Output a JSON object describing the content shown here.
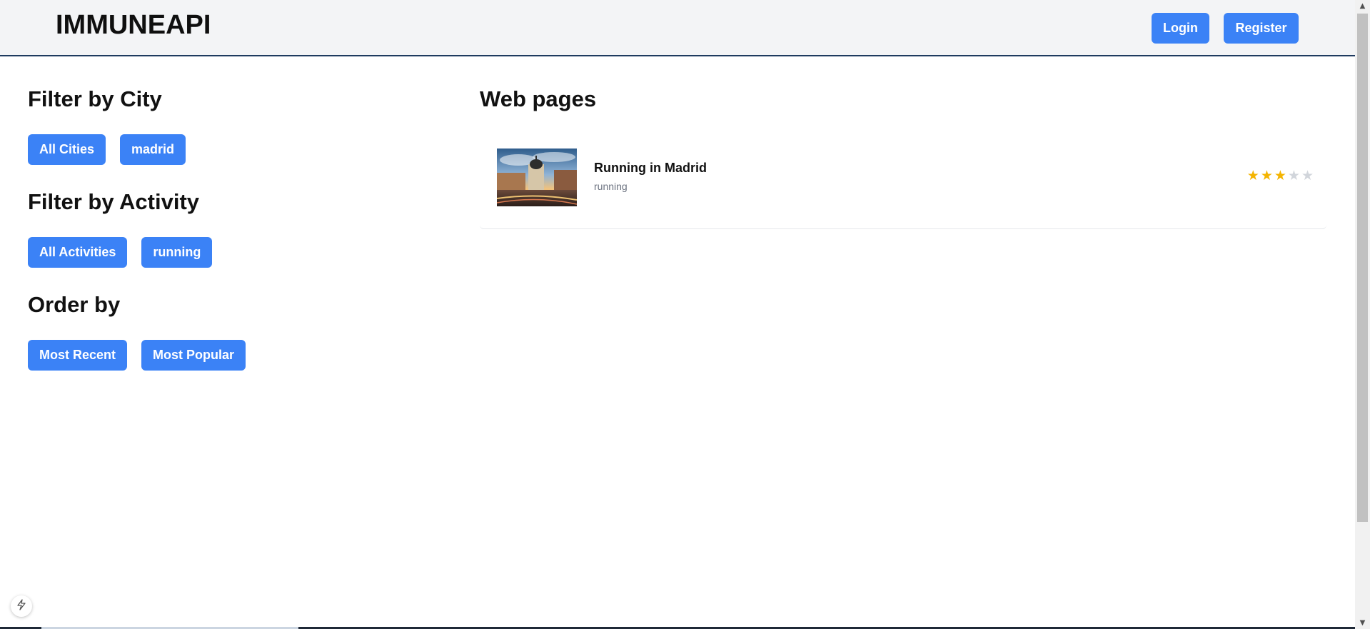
{
  "header": {
    "brand": "IMMUNEAPI",
    "login_label": "Login",
    "register_label": "Register"
  },
  "filters": {
    "city": {
      "title": "Filter by City",
      "options": [
        "All Cities",
        "madrid"
      ]
    },
    "activity": {
      "title": "Filter by Activity",
      "options": [
        "All Activities",
        "running"
      ]
    },
    "order": {
      "title": "Order by",
      "options": [
        "Most Recent",
        "Most Popular"
      ]
    }
  },
  "main": {
    "title": "Web pages",
    "items": [
      {
        "title": "Running in Madrid",
        "activity": "running",
        "rating": 3,
        "rating_max": 5
      }
    ]
  },
  "colors": {
    "primary": "#3b82f6",
    "header_bg": "#f3f4f6",
    "header_border": "#1e3a5f",
    "star_on": "#f4b400",
    "star_off": "#d1d5db"
  },
  "icons": {
    "fab": "lightning-icon",
    "star": "star-icon",
    "scroll_up": "arrow-up-icon",
    "scroll_down": "arrow-down-icon"
  }
}
